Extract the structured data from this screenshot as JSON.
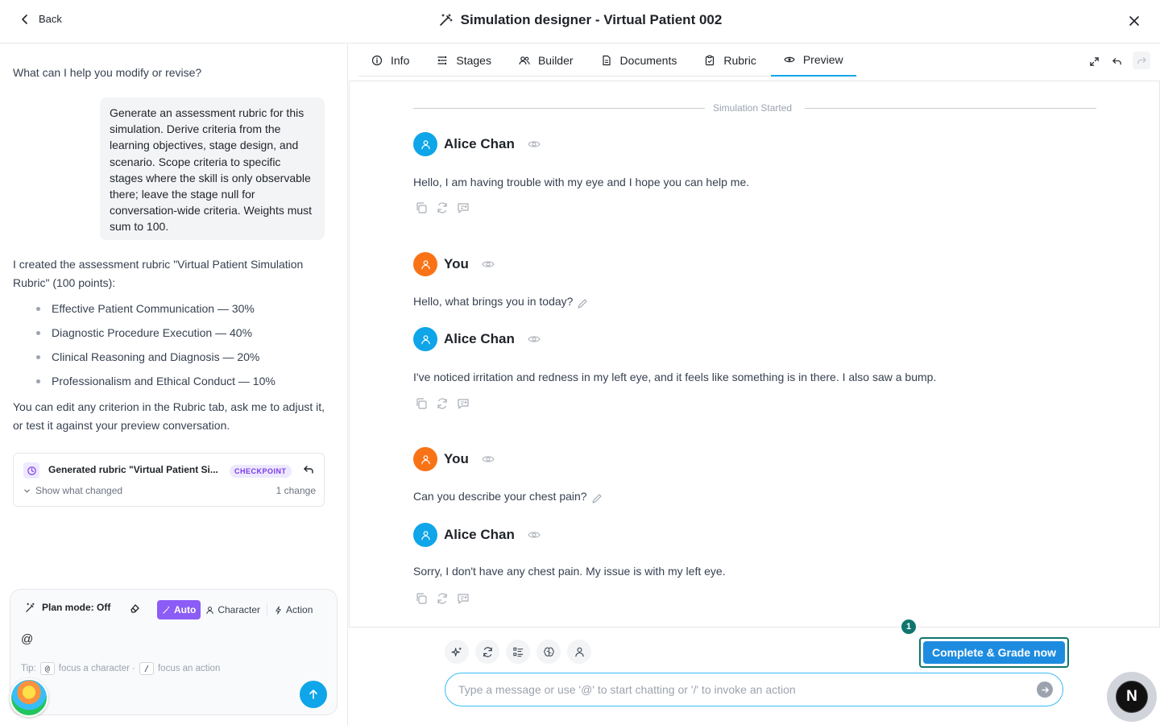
{
  "header": {
    "back_label": "Back",
    "title": "Simulation designer - Virtual Patient 002"
  },
  "left": {
    "prompt": "What can I help you modify or revise?",
    "user_message": "Generate an assessment rubric for this simulation. Derive criteria from the learning objectives, stage design, and scenario. Scope criteria to specific stages where the skill is only observable there; leave the stage null for conversation-wide criteria. Weights must sum to 100.",
    "reply_intro": "I created the assessment rubric \"Virtual Patient Simulation Rubric\" (100 points):",
    "criteria": [
      "Effective Patient Communication — 30%",
      "Diagnostic Procedure Execution — 40%",
      "Clinical Reasoning and Diagnosis — 20%",
      "Professionalism and Ethical Conduct — 10%"
    ],
    "reply_outro": "You can edit any criterion in the Rubric tab, ask me to adjust it, or test it against your preview conversation.",
    "checkpoint": {
      "title": "Generated rubric \"Virtual Patient Si...",
      "badge": "CHECKPOINT",
      "show_label": "Show what changed",
      "count": "1 change"
    },
    "composer": {
      "plan_label": "Plan mode: Off",
      "modes": [
        "Auto",
        "Character",
        "Action"
      ],
      "input_value": "@",
      "tip_prefix": "Tip:",
      "tip_key1": "@",
      "tip_text1": "focus a character ·",
      "tip_key2": "/",
      "tip_text2": "focus an action"
    }
  },
  "tabs": [
    {
      "label": "Info",
      "icon": "info-icon"
    },
    {
      "label": "Stages",
      "icon": "stages-icon"
    },
    {
      "label": "Builder",
      "icon": "users-icon"
    },
    {
      "label": "Documents",
      "icon": "document-icon"
    },
    {
      "label": "Rubric",
      "icon": "clipboard-icon"
    },
    {
      "label": "Preview",
      "icon": "eye-icon"
    }
  ],
  "active_tab": "Preview",
  "chat": {
    "divider": "Simulation Started",
    "messages": [
      {
        "author": "Alice Chan",
        "role": "patient",
        "text": "Hello, I am having trouble with my eye and I hope you can help me."
      },
      {
        "author": "You",
        "role": "user",
        "text": "Hello, what brings you in today?"
      },
      {
        "author": "Alice Chan",
        "role": "patient",
        "text": "I've noticed irritation and redness in my left eye, and it feels like something is in there. I also saw a bump."
      },
      {
        "author": "You",
        "role": "user",
        "text": "Can you describe your chest pain?"
      },
      {
        "author": "Alice Chan",
        "role": "patient",
        "text": "Sorry, I don't have any chest pain. My issue is with my left eye."
      }
    ]
  },
  "bottom": {
    "grade_button": "Complete & Grade now",
    "step_badge": "1",
    "input_placeholder": "Type a message or use '@' to start chatting or '/' to invoke an action"
  },
  "corner_badge": "N",
  "colors": {
    "accent": "#0ea5e9",
    "patient": "#0ea5e9",
    "user": "#f97316",
    "checkpoint": "#7c3aed",
    "grade": "#1d8ce0",
    "highlight": "#0f766e"
  }
}
